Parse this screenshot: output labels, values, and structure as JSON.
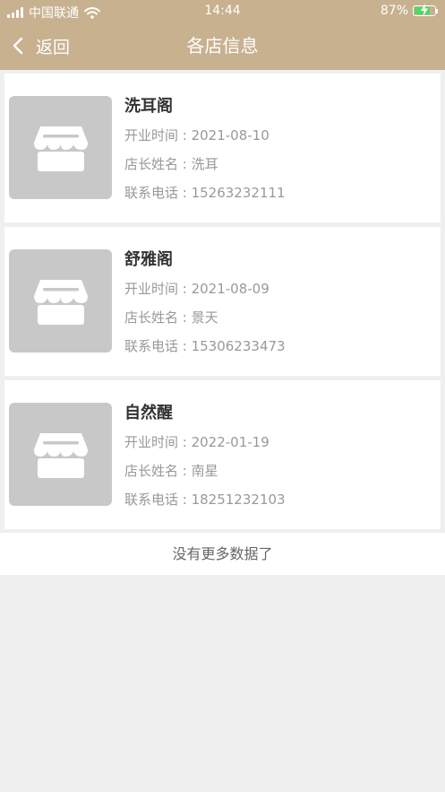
{
  "status_bar": {
    "carrier": "中国联通",
    "time": "14:44",
    "battery_text": "87%",
    "battery_level": 0.87
  },
  "nav": {
    "back_label": "返回",
    "title": "各店信息"
  },
  "labels": {
    "open_time": "开业时间 : ",
    "manager": "店长姓名 : ",
    "phone": "联系电话 : "
  },
  "shops": [
    {
      "name": "洗耳阁",
      "open_time": "2021-08-10",
      "manager": "洗耳",
      "phone": "15263232111"
    },
    {
      "name": "舒雅阁",
      "open_time": "2021-08-09",
      "manager": "景天",
      "phone": "15306233473"
    },
    {
      "name": "自然醒",
      "open_time": "2022-01-19",
      "manager": "南星",
      "phone": "18251232103"
    }
  ],
  "footer": {
    "no_more": "没有更多数据了"
  },
  "colors": {
    "header_bg": "#c7b18f",
    "page_bg": "#efefef",
    "thumb_bg": "#c9c8c9",
    "battery_fill": "#4cd964"
  }
}
